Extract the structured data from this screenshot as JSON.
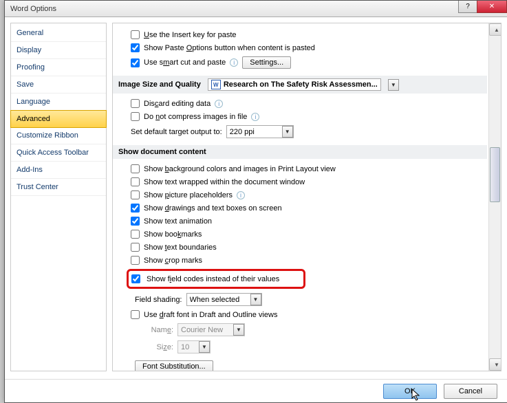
{
  "window_title": "Word Options",
  "sidebar": {
    "items": [
      "General",
      "Display",
      "Proofing",
      "Save",
      "Language",
      "Advanced",
      "Customize Ribbon",
      "Quick Access Toolbar",
      "Add-Ins",
      "Trust Center"
    ],
    "selected_index": 5
  },
  "top": {
    "use_insert": {
      "label": "Use the Insert key for paste",
      "checked": false
    },
    "show_paste": {
      "label": "Show Paste Options button when content is pasted",
      "checked": true
    },
    "smart_cut": {
      "label": "Use smart cut and paste",
      "checked": true
    },
    "settings_btn": "Settings..."
  },
  "section_image": {
    "title": "Image Size and Quality",
    "doc_name": "Research on The Safety Risk Assessmen...",
    "discard": {
      "label": "Discard editing data",
      "checked": false
    },
    "nocompress": {
      "label": "Do not compress images in file",
      "checked": false
    },
    "target_label": "Set default target output to:",
    "target_value": "220 ppi"
  },
  "section_content": {
    "title": "Show document content",
    "items": [
      {
        "label": "Show background colors and images in Print Layout view",
        "checked": false,
        "info": false
      },
      {
        "label": "Show text wrapped within the document window",
        "checked": false,
        "info": false
      },
      {
        "label": "Show picture placeholders",
        "checked": false,
        "info": true
      },
      {
        "label": "Show drawings and text boxes on screen",
        "checked": true,
        "info": false
      },
      {
        "label": "Show text animation",
        "checked": true,
        "info": false
      },
      {
        "label": "Show bookmarks",
        "checked": false,
        "info": false
      },
      {
        "label": "Show text boundaries",
        "checked": false,
        "info": false
      },
      {
        "label": "Show crop marks",
        "checked": false,
        "info": false
      }
    ],
    "highlight": {
      "label": "Show field codes instead of their values",
      "checked": true
    },
    "field_shading_label": "Field shading:",
    "field_shading_value": "When selected",
    "draft_font": {
      "label": "Use draft font in Draft and Outline views",
      "checked": false
    },
    "name_label": "Name:",
    "name_value": "Courier New",
    "size_label": "Size:",
    "size_value": "10",
    "font_sub_btn": "Font Substitution..."
  },
  "footer": {
    "ok": "OK",
    "cancel": "Cancel"
  }
}
